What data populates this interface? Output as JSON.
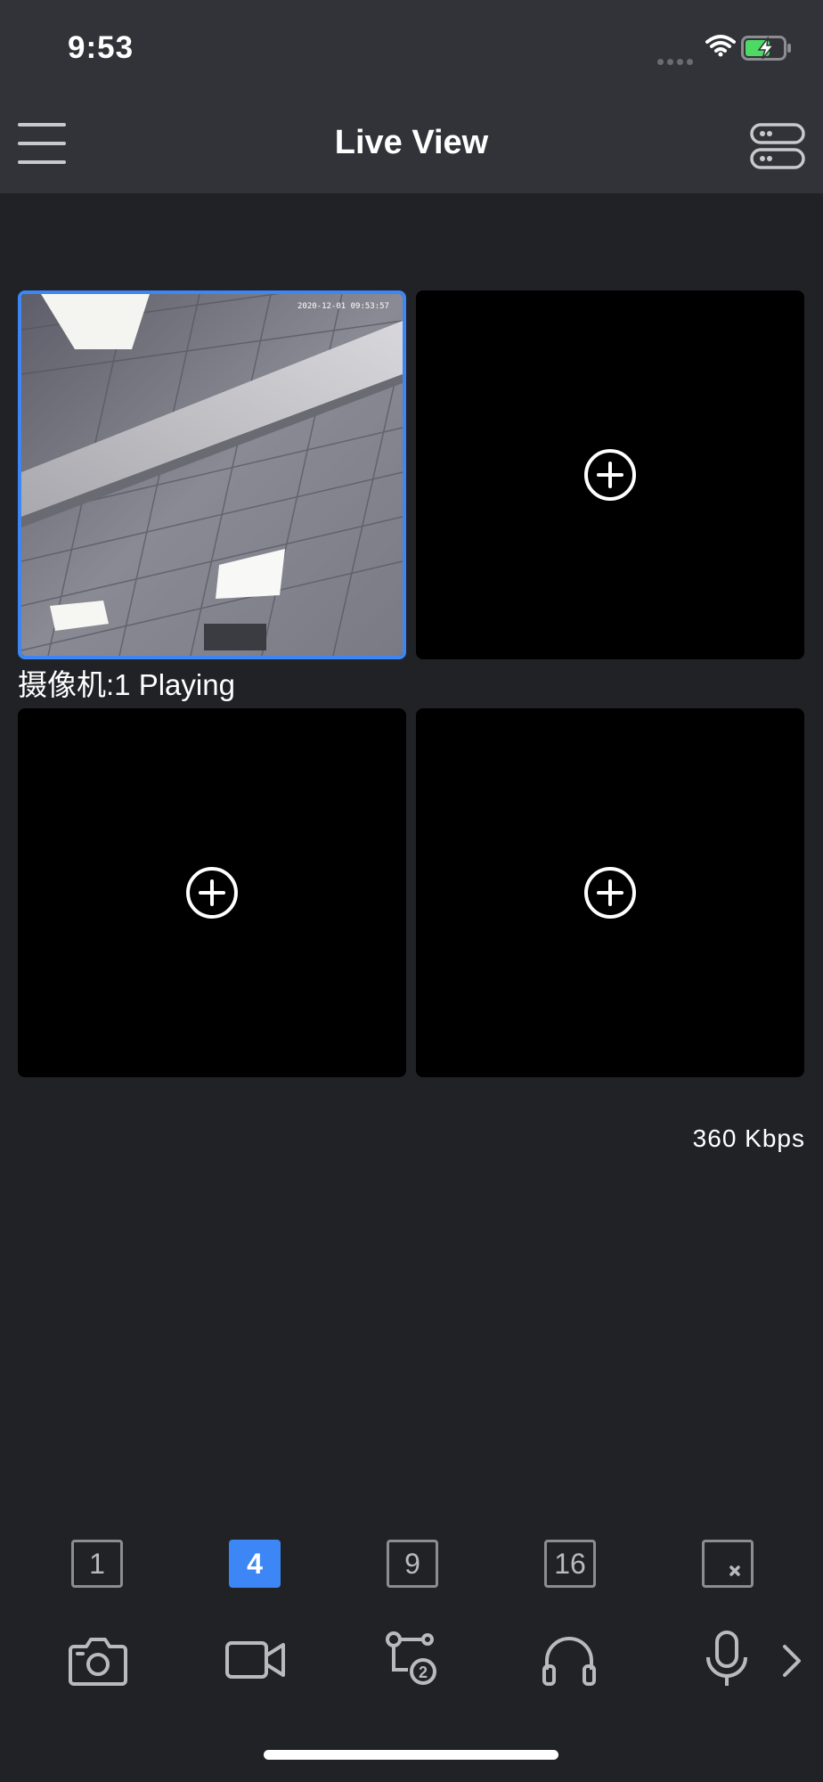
{
  "status_bar": {
    "time": "9:53"
  },
  "header": {
    "title": "Live View",
    "menu_icon": "hamburger-icon",
    "device_list_icon": "device-list-icon"
  },
  "grid": {
    "active_cell_timestamp": "2020-12-01 09:53:57",
    "active_label": "摄像机:1 Playing",
    "empty_cell_icon": "add-circle-icon"
  },
  "bitrate": "360 Kbps",
  "layout_options": [
    {
      "label": "1",
      "selected": false
    },
    {
      "label": "4",
      "selected": true
    },
    {
      "label": "9",
      "selected": false
    },
    {
      "label": "16",
      "selected": false
    },
    {
      "label": "",
      "icon": "close-split-icon",
      "selected": false
    }
  ],
  "toolbar": [
    {
      "icon": "camera-snapshot-icon"
    },
    {
      "icon": "video-record-icon"
    },
    {
      "icon": "stream-switch-icon"
    },
    {
      "icon": "headphones-icon"
    },
    {
      "icon": "microphone-icon"
    },
    {
      "icon": "chevron-right-icon"
    }
  ],
  "colors": {
    "accent": "#3d86f5",
    "background": "#212226",
    "header": "#323338"
  }
}
